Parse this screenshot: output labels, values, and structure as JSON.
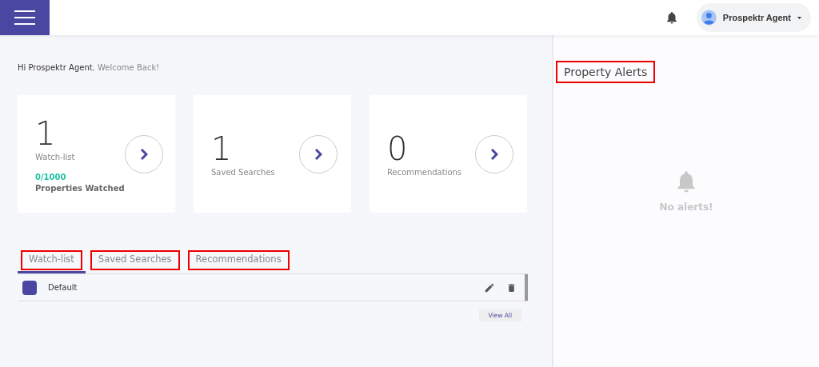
{
  "header": {
    "user": {
      "name": "Prospektr Agent"
    }
  },
  "greeting": {
    "name": "Hi Prospektr Agent",
    "text": ", Welcome Back!"
  },
  "cards": [
    {
      "count": "1",
      "label": "Watch-list",
      "quota": "0/1000",
      "quota_label": "Properties Watched"
    },
    {
      "count": "1",
      "label": "Saved Searches"
    },
    {
      "count": "0",
      "label": "Recommendations"
    }
  ],
  "tabs": [
    {
      "label": "Watch-list",
      "selected": true,
      "highlighted": true
    },
    {
      "label": "Saved Searches",
      "selected": false,
      "highlighted": true
    },
    {
      "label": "Recommendations",
      "selected": false,
      "highlighted": true
    }
  ],
  "watchlists": [
    {
      "name": "Default",
      "color": "#4a47a3"
    }
  ],
  "view_all": "View All",
  "alerts": {
    "title": "Property Alerts",
    "title_highlighted": true,
    "empty": "No alerts!"
  }
}
